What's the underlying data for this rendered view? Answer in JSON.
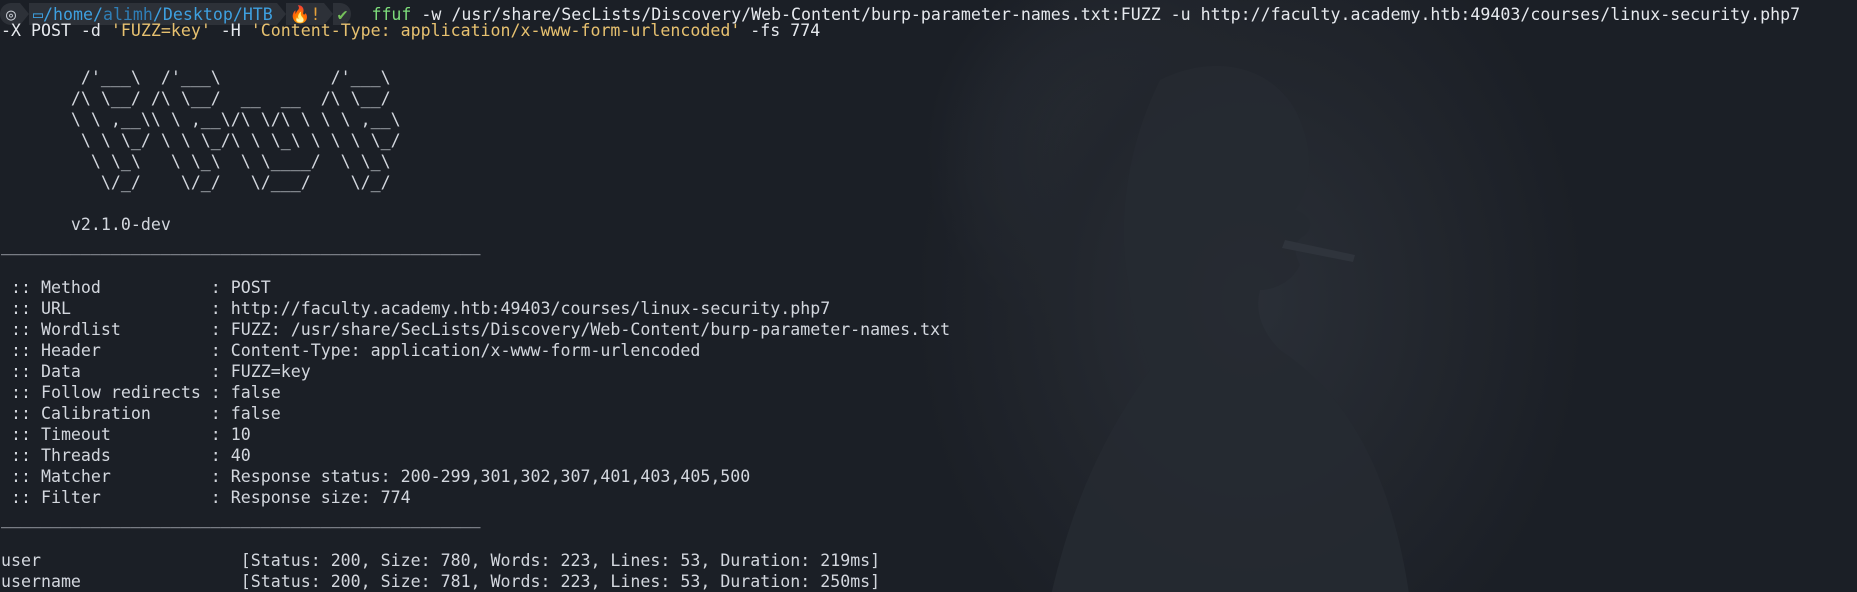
{
  "prompt": {
    "os_glyph": "◎",
    "path_prefix": "/home/",
    "path_user": "alimh",
    "path_rest": "/Desktop/HTB",
    "status_glyph": "🔥",
    "status_text": "!",
    "check_glyph": "✔"
  },
  "command": {
    "name": "ffuf",
    "line1_rest": " -w /usr/share/SecLists/Discovery/Web-Content/burp-parameter-names.txt:FUZZ -u http://faculty.academy.htb:49403/courses/linux-security.php7",
    "line2_a": "-X POST -d ",
    "line2_data": "'FUZZ=key'",
    "line2_b": " -H ",
    "line2_header": "'Content-Type: application/x-www-form-urlencoded'",
    "line2_c": " -fs 774"
  },
  "banner": {
    "ascii": [
      "        /'___\\  /'___\\           /'___\\       ",
      "       /\\ \\__/ /\\ \\__/  __  __  /\\ \\__/       ",
      "       \\ \\ ,__\\\\ \\ ,__\\/\\ \\/\\ \\ \\ \\ ,__\\      ",
      "        \\ \\ \\_/ \\ \\ \\_/\\ \\ \\_\\ \\ \\ \\ \\_/      ",
      "         \\ \\_\\   \\ \\_\\  \\ \\____/  \\ \\_\\       ",
      "          \\/_/    \\/_/   \\/___/    \\/_/       "
    ],
    "version": "       v2.1.0-dev"
  },
  "separator": "________________________________________________",
  "config": [
    {
      "key": " :: Method           : ",
      "value": "POST"
    },
    {
      "key": " :: URL              : ",
      "value": "http://faculty.academy.htb:49403/courses/linux-security.php7"
    },
    {
      "key": " :: Wordlist         : ",
      "value": "FUZZ: /usr/share/SecLists/Discovery/Web-Content/burp-parameter-names.txt"
    },
    {
      "key": " :: Header           : ",
      "value": "Content-Type: application/x-www-form-urlencoded"
    },
    {
      "key": " :: Data             : ",
      "value": "FUZZ=key"
    },
    {
      "key": " :: Follow redirects : ",
      "value": "false"
    },
    {
      "key": " :: Calibration      : ",
      "value": "false"
    },
    {
      "key": " :: Timeout          : ",
      "value": "10"
    },
    {
      "key": " :: Threads          : ",
      "value": "40"
    },
    {
      "key": " :: Matcher          : ",
      "value": "Response status: 200-299,301,302,307,401,403,405,500"
    },
    {
      "key": " :: Filter           : ",
      "value": "Response size: 774"
    }
  ],
  "results": [
    {
      "word": "user                    ",
      "info": "[Status: 200, Size: 780, Words: 223, Lines: 53, Duration: 219ms]"
    },
    {
      "word": "username                ",
      "info": "[Status: 200, Size: 781, Words: 223, Lines: 53, Duration: 250ms]"
    }
  ],
  "colors": {
    "background": "#1b1f26",
    "path": "#3ea0e0",
    "command": "#7ddc7a",
    "string": "#e7c170",
    "text": "#d3d7de"
  }
}
